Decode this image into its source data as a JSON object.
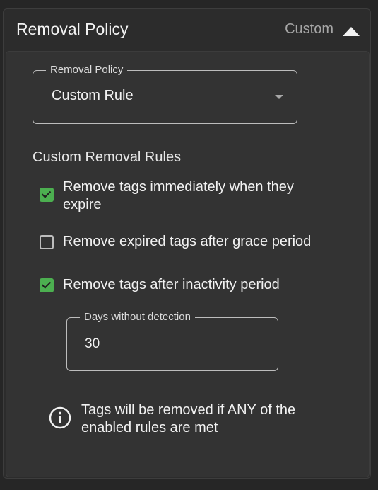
{
  "panel": {
    "title": "Removal Policy",
    "status": "Custom",
    "expand_icon": "caret-up-icon"
  },
  "policy_select": {
    "label": "Removal Policy",
    "value": "Custom Rule"
  },
  "rules": {
    "title": "Custom Removal Rules",
    "items": [
      {
        "label": "Remove tags immediately when they expire",
        "checked": true
      },
      {
        "label": "Remove expired tags after grace period",
        "checked": false
      },
      {
        "label": "Remove tags after inactivity period",
        "checked": true
      }
    ]
  },
  "days_field": {
    "label": "Days without detection",
    "value": "30"
  },
  "info": {
    "icon": "info-circle-icon",
    "text": "Tags will be removed if ANY of the enabled rules are met"
  },
  "colors": {
    "checkbox_checked": "#4caf50",
    "background": "#262626",
    "panel": "#333333"
  }
}
